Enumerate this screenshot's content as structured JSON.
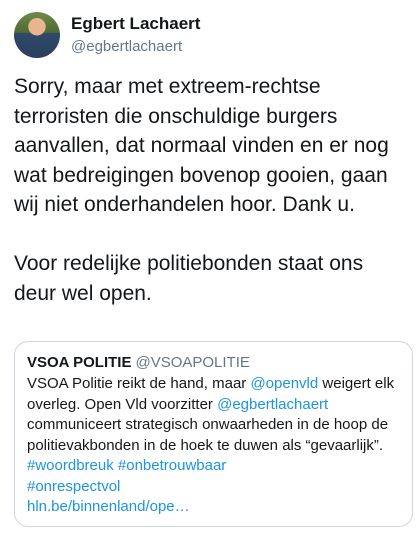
{
  "author": {
    "display_name": "Egbert Lachaert",
    "handle": "@egbertlachaert"
  },
  "tweet": {
    "paragraph_1": "Sorry, maar met extreem-rechtse terroristen die onschuldige burgers aanvallen, dat normaal vinden en er nog wat bedreigingen bovenop gooien, gaan wij niet onderhandelen hoor. Dank u.",
    "paragraph_2": "Voor redelijke politiebonden staat ons deur wel open."
  },
  "quoted_tweet": {
    "display_name": "VSOA POLITIE",
    "handle": "@VSOAPOLITIE",
    "text_1": "VSOA Politie reikt de hand, maar ",
    "mention_1": "@openvld",
    "text_2": " weigert elk overleg. Open Vld voorzitter ",
    "mention_2": "@egbertlachaert",
    "text_3": " communiceert strategisch onwaarheden in de hoop de politievakbonden in de hoek te duwen als “gevaarlijk”. ",
    "hashtag_1": "#woordbreuk",
    "text_4": " ",
    "hashtag_2": "#onbetrouwbaar",
    "hashtag_3": "#onrespectvol",
    "link": "hln.be/binnenland/ope…"
  },
  "colors": {
    "link": "#1b95e0",
    "text": "#14171a",
    "secondary": "#657786",
    "border": "#ccd6dd"
  }
}
